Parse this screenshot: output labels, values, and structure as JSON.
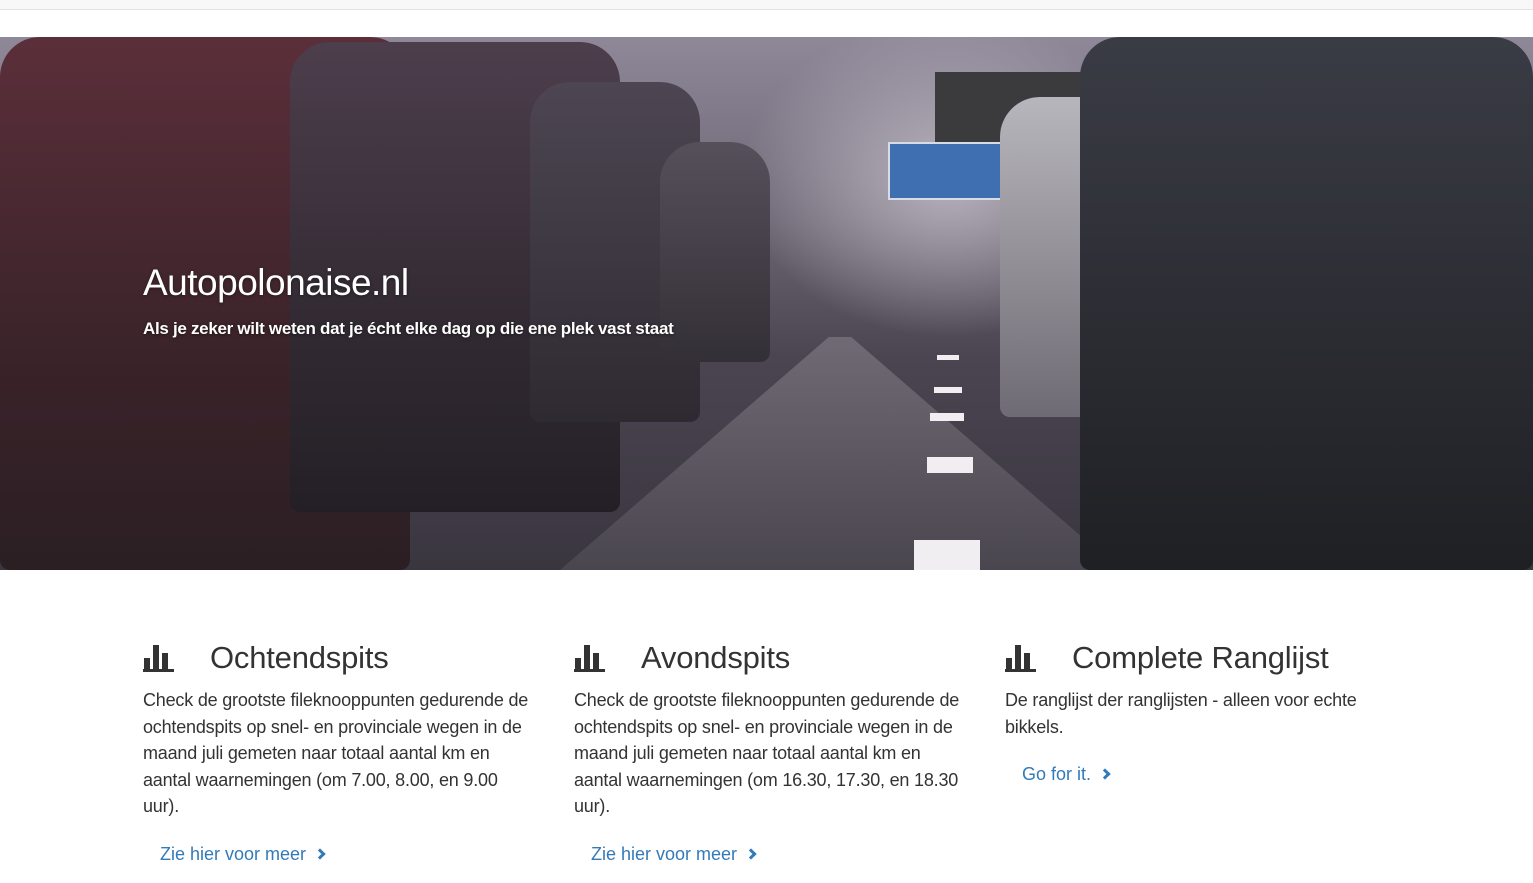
{
  "hero": {
    "title": "Autopolonaise.nl",
    "subtitle": "Als je zeker wilt weten dat je écht elke dag op die ene plek vast staat"
  },
  "columns": [
    {
      "icon": "bar-chart-icon",
      "title": "Ochtendspits",
      "text": "Check de grootste fileknooppunten gedurende de ochtendspits op snel- en provinciale wegen in de maand juli gemeten naar totaal aantal km en aantal waarnemingen (om 7.00, 8.00, en 9.00 uur).",
      "link": "Zie hier voor meer"
    },
    {
      "icon": "bar-chart-icon",
      "title": "Avondspits",
      "text": "Check de grootste fileknooppunten gedurende de ochtendspits op snel- en provinciale wegen in de maand juli gemeten naar totaal aantal km en aantal waarnemingen (om 16.30, 17.30, en 18.30 uur).",
      "link": "Zie hier voor meer"
    },
    {
      "icon": "bar-chart-icon",
      "title": "Complete Ranglijst",
      "text": "De ranglijst der ranglijsten - alleen voor echte bikkels.",
      "link": "Go for it."
    }
  ],
  "colors": {
    "link": "#337ab7",
    "text": "#333333"
  }
}
